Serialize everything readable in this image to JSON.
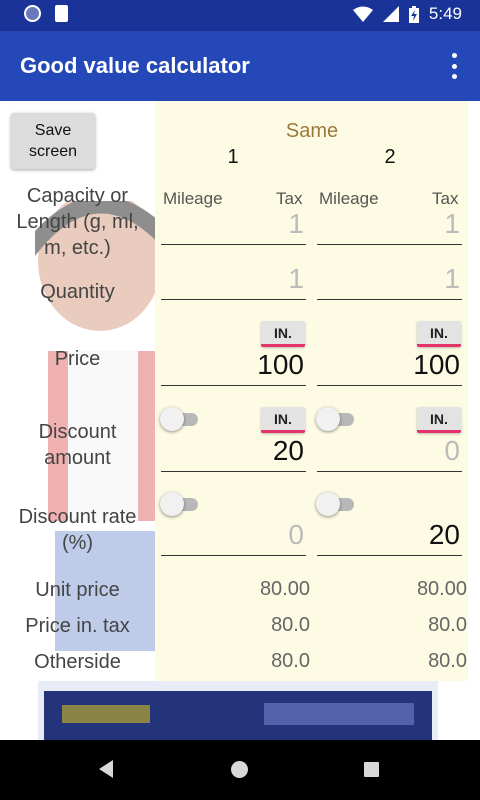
{
  "status": {
    "time": "5:49"
  },
  "app": {
    "title": "Good value calculator"
  },
  "save_button": "Save\nscreen",
  "same_label": "Same",
  "columns": [
    "1",
    "2"
  ],
  "sub_labels": {
    "mileage": "Mileage",
    "tax": "Tax"
  },
  "rows": {
    "capacity": "Capacity or\nLength (g, ml,\nm, etc.)",
    "quantity": "Quantity",
    "price": "Price",
    "discount_amount": "Discount\namount",
    "discount_rate": "Discount rate\n(%)",
    "unit_price": "Unit price",
    "price_in_tax": "Price in. tax",
    "otherside": "Otherside"
  },
  "in_button": "IN.",
  "col1": {
    "capacity_placeholder": "1",
    "quantity_placeholder": "1",
    "price": "100",
    "discount_amount": "20",
    "discount_rate_placeholder": "0",
    "unit_price": "80.00",
    "price_in_tax": "80.0",
    "otherside": "80.0"
  },
  "col2": {
    "capacity_placeholder": "1",
    "quantity_placeholder": "1",
    "price": "100",
    "discount_amount_placeholder": "0",
    "discount_rate": "20",
    "unit_price": "80.00",
    "price_in_tax": "80.0",
    "otherside": "80.0"
  },
  "colors": {
    "appbar": "#2548b8",
    "statusbar": "#1a3398",
    "accent": "#e2336b",
    "same_label": "#9a7a3a"
  }
}
